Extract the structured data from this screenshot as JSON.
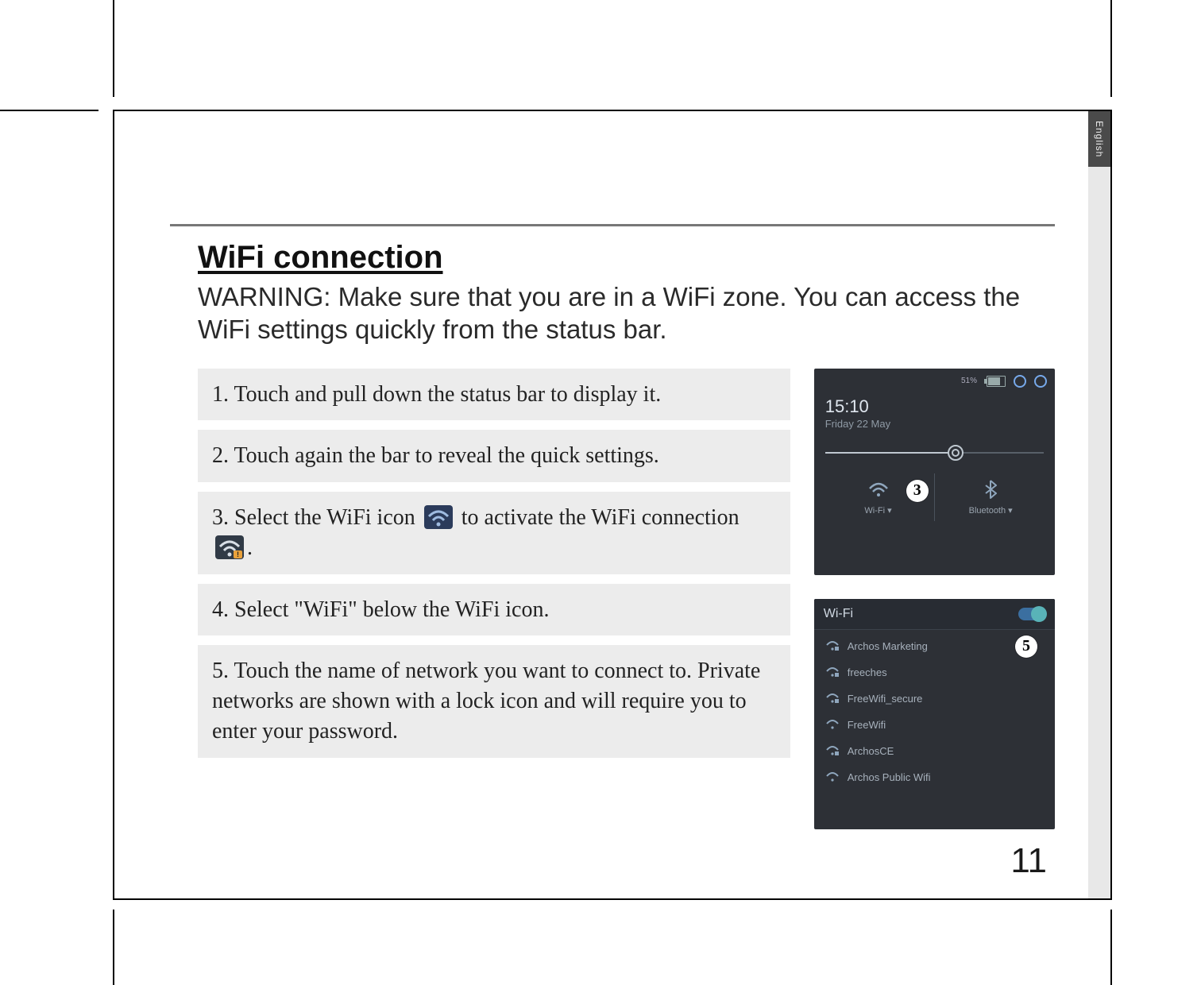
{
  "language_tab": "English",
  "title": "WiFi connection",
  "warning": "WARNING:  Make sure that you are in a WiFi zone. You can access the WiFi settings quickly from the status bar.",
  "steps": {
    "s1": "1.  Touch and pull down the status bar to display it.",
    "s2": "2.  Touch again the bar to reveal the quick settings.",
    "s3_a": "3.  Select the WiFi icon",
    "s3_b": "to activate the WiFi connection",
    "s3_c": ".",
    "s4": "4.  Select \"WiFi\" below the WiFi icon.",
    "s5": "5.  Touch the name of network you want to connect to. Private networks are shown with a lock icon and will require you to enter your password."
  },
  "shot1": {
    "battery_pct": "51%",
    "time": "15:10",
    "date": "Friday 22 May",
    "tile_wifi_label": "Wi-Fi ▾",
    "tile_bt_label": "Bluetooth ▾",
    "badge": "3"
  },
  "shot2": {
    "header": "Wi-Fi",
    "badge": "5",
    "networks": [
      "Archos Marketing",
      "freeches",
      "FreeWifi_secure",
      "FreeWifi",
      "ArchosCE",
      "Archos Public Wifi"
    ]
  },
  "page_number": "11"
}
